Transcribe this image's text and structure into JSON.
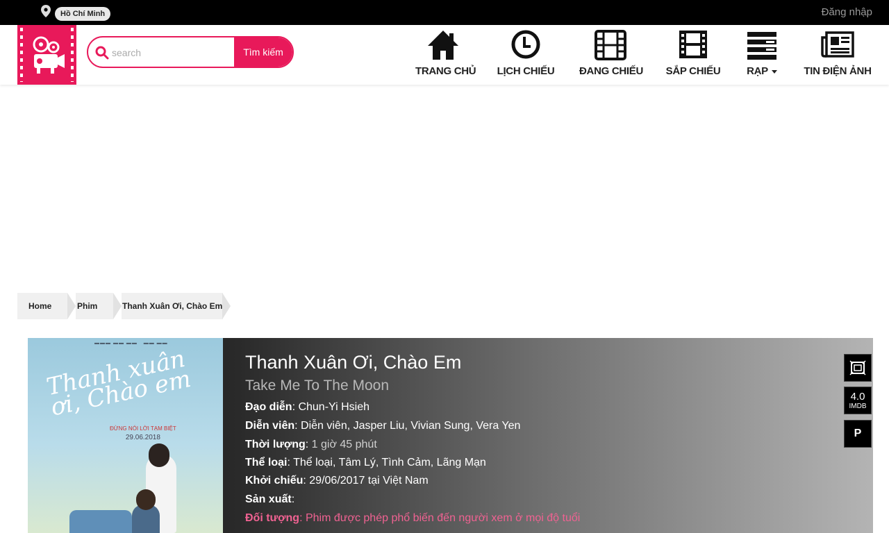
{
  "topbar": {
    "location_icon": "map-marker-icon",
    "city": "Hồ Chí Minh",
    "login": "Đăng nhập"
  },
  "colors": {
    "brand": "#e8195a",
    "topbar_bg": "#000000",
    "audience_text": "#f06292"
  },
  "header": {
    "logo_icon": "film-projector-icon",
    "search": {
      "placeholder": "search",
      "value": "",
      "button": "Tìm kiếm",
      "icon": "search-icon"
    },
    "nav": [
      {
        "label": "TRANG CHỦ",
        "icon": "home-icon"
      },
      {
        "label": "LỊCH CHIẾU",
        "icon": "clock-icon"
      },
      {
        "label": "ĐANG CHIẾU",
        "icon": "film-icon"
      },
      {
        "label": "SẮP CHIẾU",
        "icon": "film-strip-icon"
      },
      {
        "label": "RẠP",
        "icon": "list-icon"
      },
      {
        "label": "TIN ĐIỆN ẢNH",
        "icon": "newspaper-icon"
      }
    ]
  },
  "breadcrumb": [
    "Home",
    "Phim",
    "Thanh Xuân Ơi, Chào Em"
  ],
  "movie": {
    "title_vi": "Thanh Xuân Ơi, Chào Em",
    "title_en": "Take Me To The Moon",
    "poster": {
      "script_title": "Thanh xuân ơi, Chào em",
      "tagline": "ĐỪNG NÓI LỜI TẠM BIỆT",
      "date": "29.06.2018"
    },
    "details": [
      {
        "label": "Đạo diễn",
        "value": "Chun-Yi Hsieh"
      },
      {
        "label": "Diễn viên",
        "value": "Diễn viên, Jasper Liu, Vivian Sung, Vera Yen"
      },
      {
        "label": "Thời lượng",
        "value": "1 giờ 45 phút"
      },
      {
        "label": "Thể loại",
        "value": "Thể loại, Tâm Lý, Tình Cảm, Lãng Mạn"
      },
      {
        "label": "Khởi chiếu",
        "value": "29/06/2017 tại Việt Nam"
      },
      {
        "label": "Sản xuất",
        "value": ""
      }
    ],
    "audience": {
      "label": "Đối tượng",
      "value": "Phim được phép phổ biến đến người xem ở mọi độ tuổi"
    },
    "side_buttons": {
      "trailer_icon": "trailer-frame-icon",
      "imdb_score": "4.0",
      "imdb_label": "IMDB",
      "rating": "P"
    }
  }
}
